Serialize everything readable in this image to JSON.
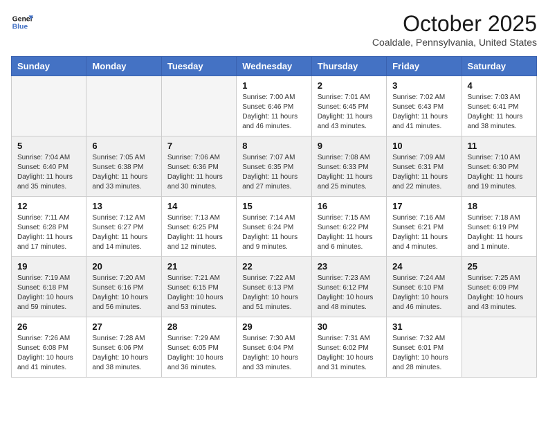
{
  "header": {
    "logo_line1": "General",
    "logo_line2": "Blue",
    "month": "October 2025",
    "location": "Coaldale, Pennsylvania, United States"
  },
  "days_of_week": [
    "Sunday",
    "Monday",
    "Tuesday",
    "Wednesday",
    "Thursday",
    "Friday",
    "Saturday"
  ],
  "weeks": [
    [
      {
        "day": "",
        "info": ""
      },
      {
        "day": "",
        "info": ""
      },
      {
        "day": "",
        "info": ""
      },
      {
        "day": "1",
        "info": "Sunrise: 7:00 AM\nSunset: 6:46 PM\nDaylight: 11 hours\nand 46 minutes."
      },
      {
        "day": "2",
        "info": "Sunrise: 7:01 AM\nSunset: 6:45 PM\nDaylight: 11 hours\nand 43 minutes."
      },
      {
        "day": "3",
        "info": "Sunrise: 7:02 AM\nSunset: 6:43 PM\nDaylight: 11 hours\nand 41 minutes."
      },
      {
        "day": "4",
        "info": "Sunrise: 7:03 AM\nSunset: 6:41 PM\nDaylight: 11 hours\nand 38 minutes."
      }
    ],
    [
      {
        "day": "5",
        "info": "Sunrise: 7:04 AM\nSunset: 6:40 PM\nDaylight: 11 hours\nand 35 minutes."
      },
      {
        "day": "6",
        "info": "Sunrise: 7:05 AM\nSunset: 6:38 PM\nDaylight: 11 hours\nand 33 minutes."
      },
      {
        "day": "7",
        "info": "Sunrise: 7:06 AM\nSunset: 6:36 PM\nDaylight: 11 hours\nand 30 minutes."
      },
      {
        "day": "8",
        "info": "Sunrise: 7:07 AM\nSunset: 6:35 PM\nDaylight: 11 hours\nand 27 minutes."
      },
      {
        "day": "9",
        "info": "Sunrise: 7:08 AM\nSunset: 6:33 PM\nDaylight: 11 hours\nand 25 minutes."
      },
      {
        "day": "10",
        "info": "Sunrise: 7:09 AM\nSunset: 6:31 PM\nDaylight: 11 hours\nand 22 minutes."
      },
      {
        "day": "11",
        "info": "Sunrise: 7:10 AM\nSunset: 6:30 PM\nDaylight: 11 hours\nand 19 minutes."
      }
    ],
    [
      {
        "day": "12",
        "info": "Sunrise: 7:11 AM\nSunset: 6:28 PM\nDaylight: 11 hours\nand 17 minutes."
      },
      {
        "day": "13",
        "info": "Sunrise: 7:12 AM\nSunset: 6:27 PM\nDaylight: 11 hours\nand 14 minutes."
      },
      {
        "day": "14",
        "info": "Sunrise: 7:13 AM\nSunset: 6:25 PM\nDaylight: 11 hours\nand 12 minutes."
      },
      {
        "day": "15",
        "info": "Sunrise: 7:14 AM\nSunset: 6:24 PM\nDaylight: 11 hours\nand 9 minutes."
      },
      {
        "day": "16",
        "info": "Sunrise: 7:15 AM\nSunset: 6:22 PM\nDaylight: 11 hours\nand 6 minutes."
      },
      {
        "day": "17",
        "info": "Sunrise: 7:16 AM\nSunset: 6:21 PM\nDaylight: 11 hours\nand 4 minutes."
      },
      {
        "day": "18",
        "info": "Sunrise: 7:18 AM\nSunset: 6:19 PM\nDaylight: 11 hours\nand 1 minute."
      }
    ],
    [
      {
        "day": "19",
        "info": "Sunrise: 7:19 AM\nSunset: 6:18 PM\nDaylight: 10 hours\nand 59 minutes."
      },
      {
        "day": "20",
        "info": "Sunrise: 7:20 AM\nSunset: 6:16 PM\nDaylight: 10 hours\nand 56 minutes."
      },
      {
        "day": "21",
        "info": "Sunrise: 7:21 AM\nSunset: 6:15 PM\nDaylight: 10 hours\nand 53 minutes."
      },
      {
        "day": "22",
        "info": "Sunrise: 7:22 AM\nSunset: 6:13 PM\nDaylight: 10 hours\nand 51 minutes."
      },
      {
        "day": "23",
        "info": "Sunrise: 7:23 AM\nSunset: 6:12 PM\nDaylight: 10 hours\nand 48 minutes."
      },
      {
        "day": "24",
        "info": "Sunrise: 7:24 AM\nSunset: 6:10 PM\nDaylight: 10 hours\nand 46 minutes."
      },
      {
        "day": "25",
        "info": "Sunrise: 7:25 AM\nSunset: 6:09 PM\nDaylight: 10 hours\nand 43 minutes."
      }
    ],
    [
      {
        "day": "26",
        "info": "Sunrise: 7:26 AM\nSunset: 6:08 PM\nDaylight: 10 hours\nand 41 minutes."
      },
      {
        "day": "27",
        "info": "Sunrise: 7:28 AM\nSunset: 6:06 PM\nDaylight: 10 hours\nand 38 minutes."
      },
      {
        "day": "28",
        "info": "Sunrise: 7:29 AM\nSunset: 6:05 PM\nDaylight: 10 hours\nand 36 minutes."
      },
      {
        "day": "29",
        "info": "Sunrise: 7:30 AM\nSunset: 6:04 PM\nDaylight: 10 hours\nand 33 minutes."
      },
      {
        "day": "30",
        "info": "Sunrise: 7:31 AM\nSunset: 6:02 PM\nDaylight: 10 hours\nand 31 minutes."
      },
      {
        "day": "31",
        "info": "Sunrise: 7:32 AM\nSunset: 6:01 PM\nDaylight: 10 hours\nand 28 minutes."
      },
      {
        "day": "",
        "info": ""
      }
    ]
  ]
}
